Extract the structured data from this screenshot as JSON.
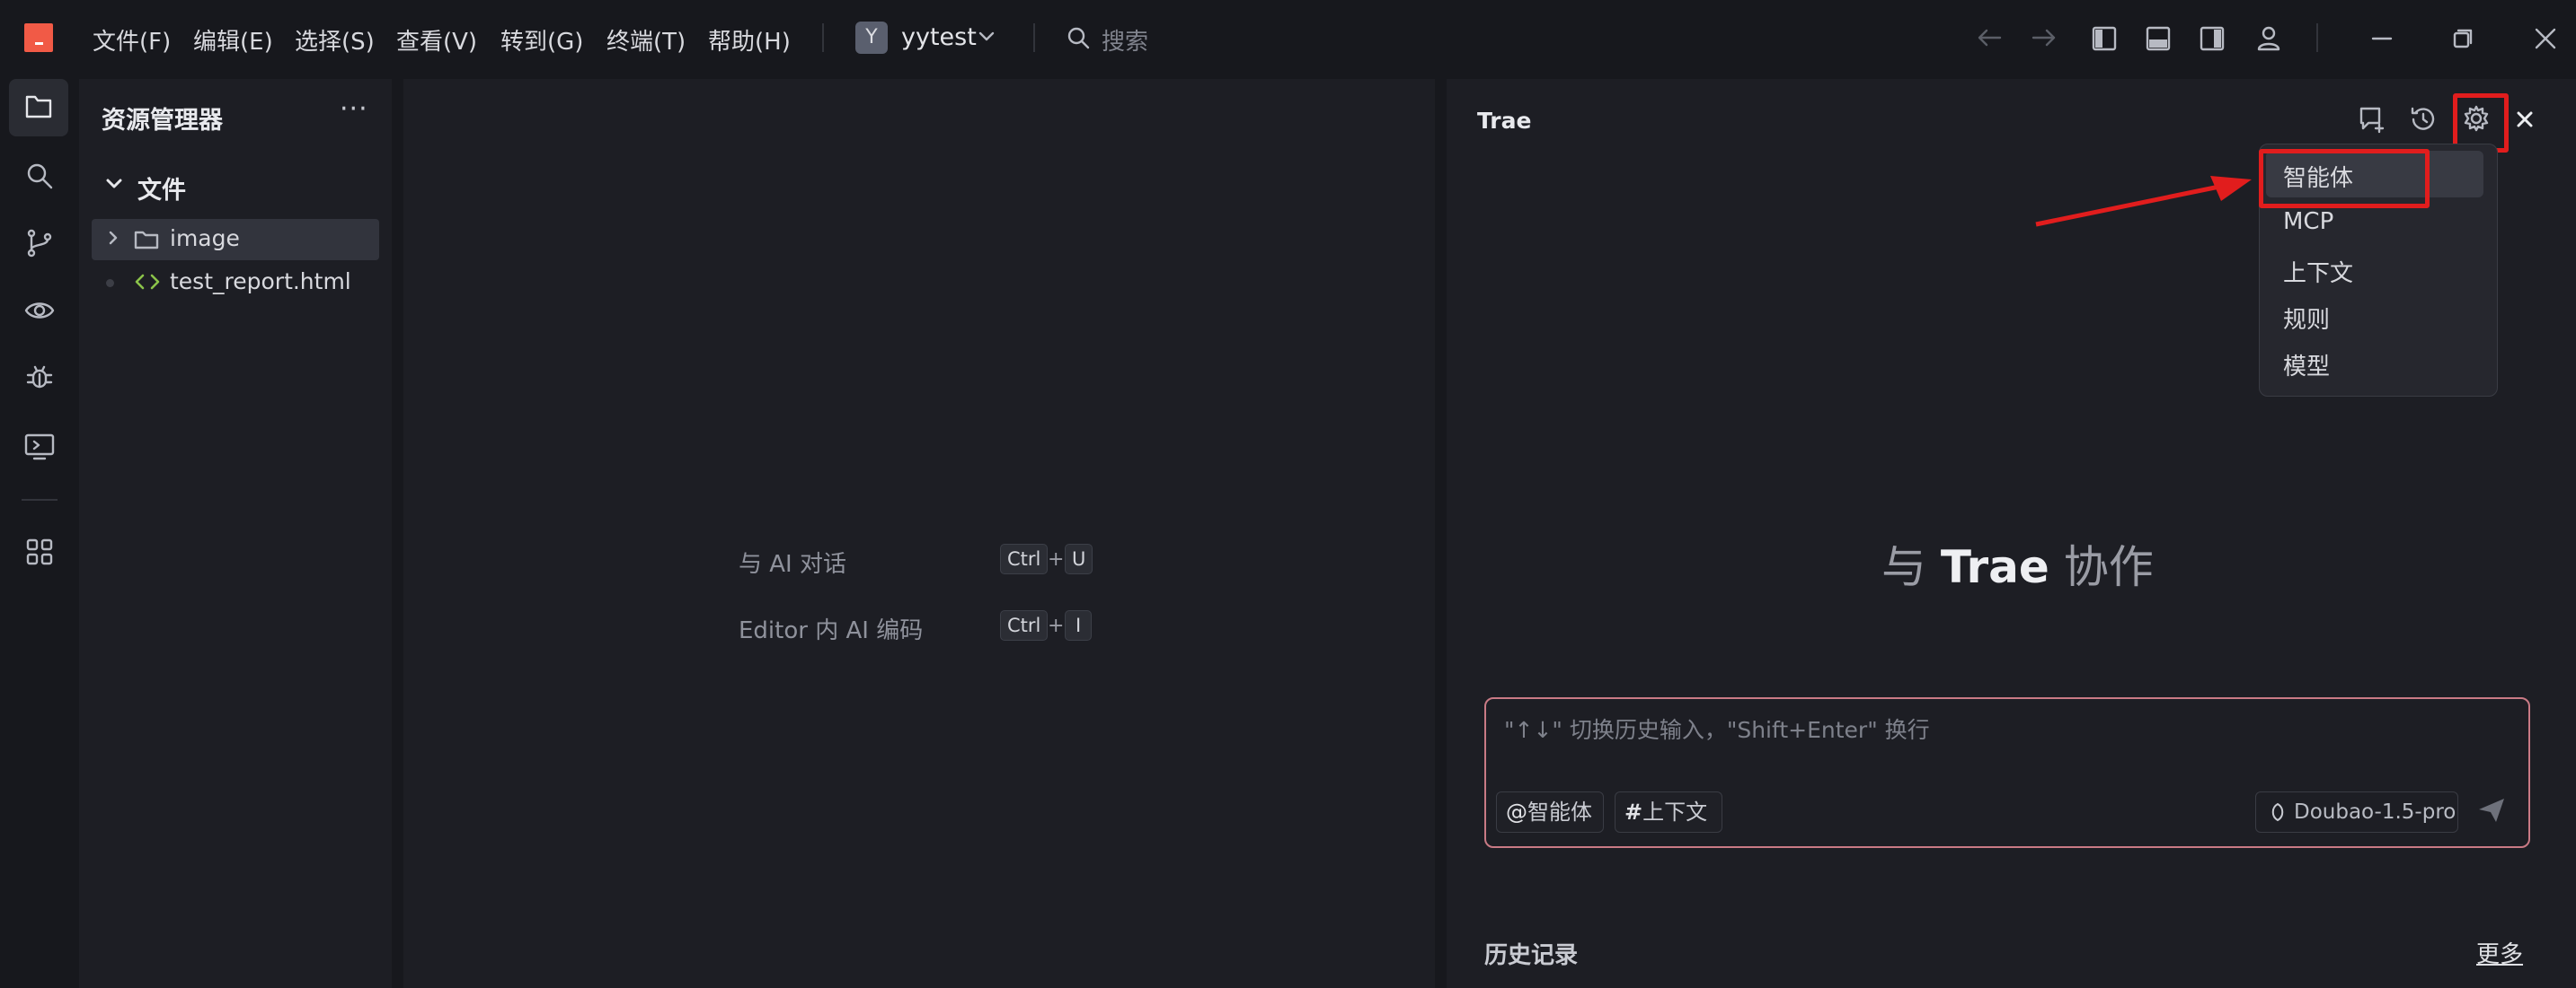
{
  "menu": {
    "items": [
      "文件(F)",
      "编辑(E)",
      "选择(S)",
      "查看(V)",
      "转到(G)",
      "终端(T)",
      "帮助(H)"
    ]
  },
  "workspace": {
    "avatar_letter": "Y",
    "name": "yytest"
  },
  "search": {
    "placeholder": "搜索"
  },
  "explorer": {
    "title": "资源管理器",
    "more": "···",
    "section": "文件",
    "items": [
      {
        "name": "image",
        "type": "folder"
      },
      {
        "name": "test_report.html",
        "type": "file"
      }
    ]
  },
  "editor": {
    "hints": [
      {
        "label": "与 AI 对话",
        "keys": [
          "Ctrl",
          "U"
        ]
      },
      {
        "label": "Editor 内 AI 编码",
        "keys": [
          "Ctrl",
          "I"
        ]
      }
    ],
    "plus": "+"
  },
  "trae": {
    "title": "Trae",
    "dropdown": [
      "智能体",
      "MCP",
      "上下文",
      "规则",
      "模型"
    ],
    "collab_prefix": "与",
    "collab_brand": "Trae",
    "collab_suffix": "协作",
    "input_placeholder": "\"↑↓\" 切换历史输入，\"Shift+Enter\" 换行",
    "chips": [
      {
        "symbol": "@",
        "label": "智能体"
      },
      {
        "symbol": "#",
        "label": "上下文"
      }
    ],
    "model": "Doubao-1.5-pro",
    "history_title": "历史记录",
    "more": "更多"
  },
  "colors": {
    "accent": "#f15a46",
    "highlight": "#e11d1d",
    "background": "#17181d",
    "panel": "#1d1e24"
  }
}
